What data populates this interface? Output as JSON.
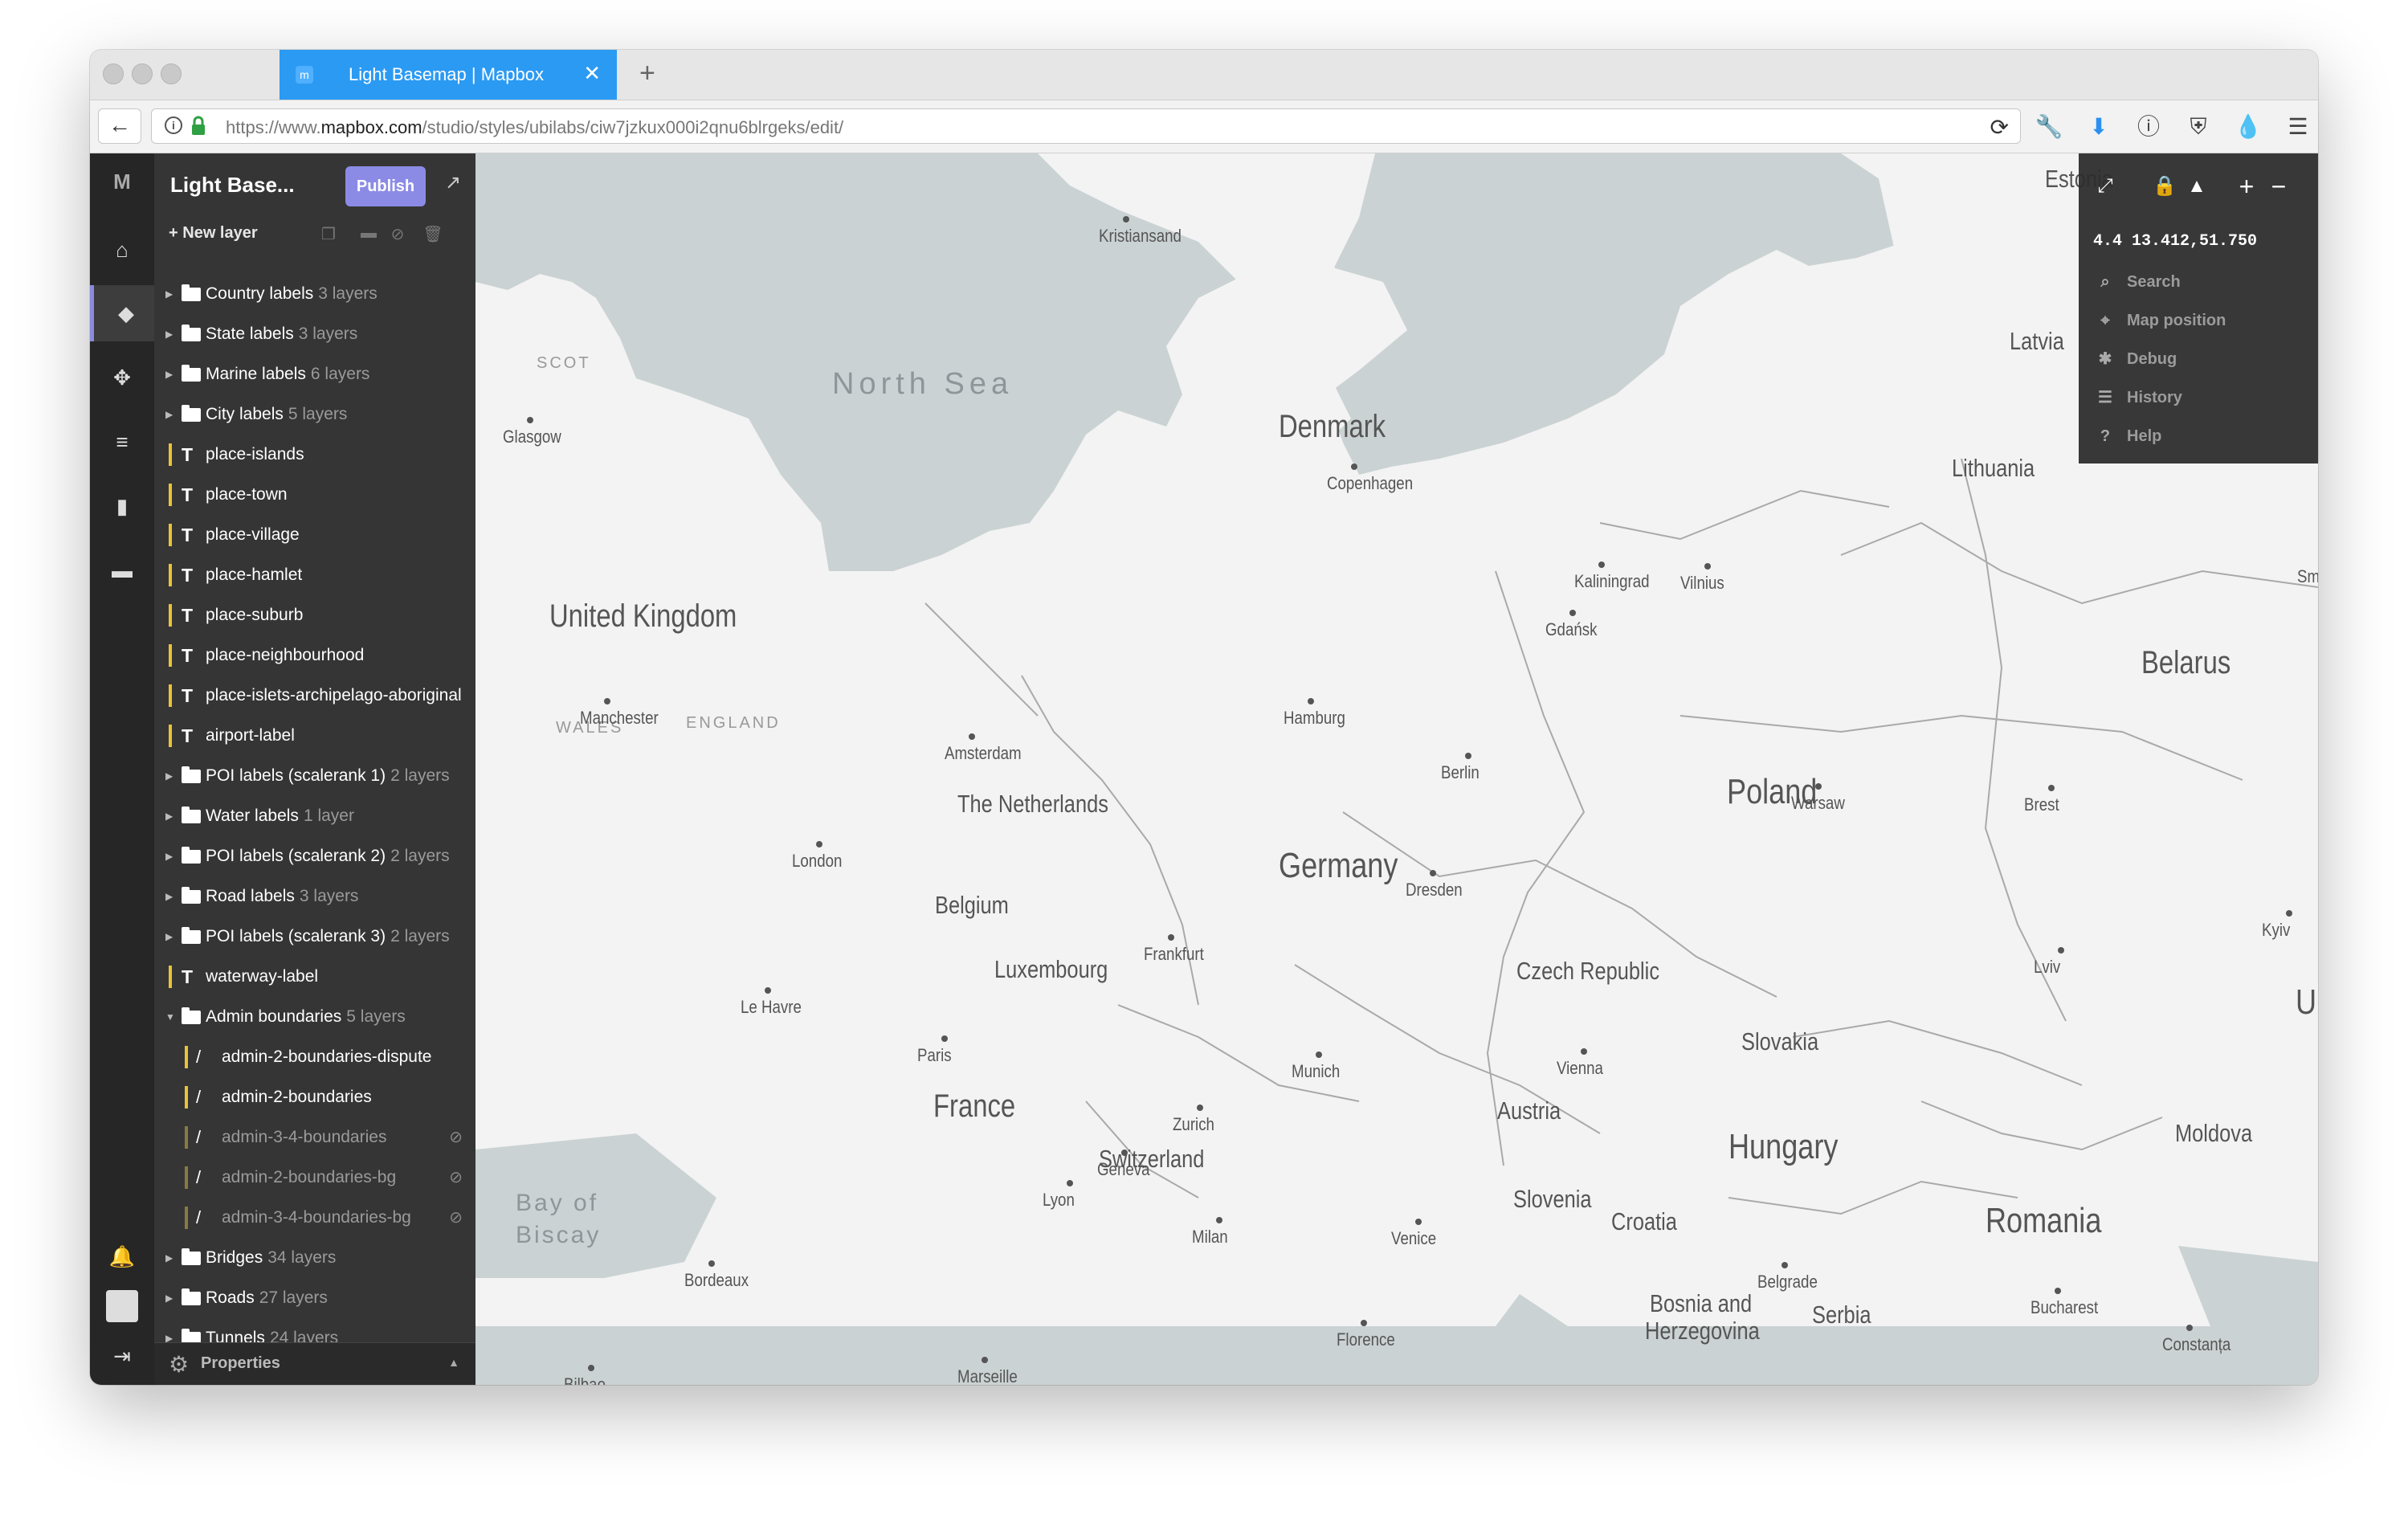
{
  "browser": {
    "tab_title": "Light Basemap | Mapbox",
    "tab_close": "✕",
    "new_tab": "+",
    "url_prefix": "https://www.",
    "url_domain": "mapbox.com",
    "url_path": "/studio/styles/ubilabs/ciw7jzkux000i2qnu6blrgeks/edit/"
  },
  "panel": {
    "style_name": "Light Base...",
    "publish_label": "Publish",
    "new_layer_label": "New layer",
    "properties_label": "Properties",
    "layers": [
      {
        "type": "group",
        "name": "Country labels",
        "count": "3 layers"
      },
      {
        "type": "group",
        "name": "State labels",
        "count": "3 layers"
      },
      {
        "type": "group",
        "name": "Marine labels",
        "count": "6 layers"
      },
      {
        "type": "group",
        "name": "City labels",
        "count": "5 layers"
      },
      {
        "type": "symbol",
        "name": "place-islands"
      },
      {
        "type": "symbol",
        "name": "place-town"
      },
      {
        "type": "symbol",
        "name": "place-village"
      },
      {
        "type": "symbol",
        "name": "place-hamlet"
      },
      {
        "type": "symbol",
        "name": "place-suburb"
      },
      {
        "type": "symbol",
        "name": "place-neighbourhood"
      },
      {
        "type": "symbol",
        "name": "place-islets-archipelago-aboriginal"
      },
      {
        "type": "symbol",
        "name": "airport-label"
      },
      {
        "type": "group",
        "name": "POI labels (scalerank 1)",
        "count": "2 layers"
      },
      {
        "type": "group",
        "name": "Water labels",
        "count": "1 layer"
      },
      {
        "type": "group",
        "name": "POI labels (scalerank 2)",
        "count": "2 layers"
      },
      {
        "type": "group",
        "name": "Road labels",
        "count": "3 layers"
      },
      {
        "type": "group",
        "name": "POI labels (scalerank 3)",
        "count": "2 layers"
      },
      {
        "type": "symbol",
        "name": "waterway-label"
      },
      {
        "type": "group-open",
        "name": "Admin boundaries",
        "count": "5 layers"
      },
      {
        "type": "line",
        "name": "admin-2-boundaries-dispute"
      },
      {
        "type": "line",
        "name": "admin-2-boundaries"
      },
      {
        "type": "line-hidden",
        "name": "admin-3-4-boundaries"
      },
      {
        "type": "line-hidden",
        "name": "admin-2-boundaries-bg"
      },
      {
        "type": "line-hidden",
        "name": "admin-3-4-boundaries-bg"
      },
      {
        "type": "group",
        "name": "Bridges",
        "count": "34 layers"
      },
      {
        "type": "group",
        "name": "Roads",
        "count": "27 layers"
      },
      {
        "type": "group",
        "name": "Tunnels",
        "count": "24 layers"
      }
    ]
  },
  "map_controls": {
    "coords": "4.4 13.412,51.750",
    "menu": [
      "Search",
      "Map position",
      "Debug",
      "History",
      "Help"
    ]
  },
  "map_labels": {
    "countries": [
      "Estonia",
      "Latvia",
      "Lithuania",
      "Denmark",
      "United Kingdom",
      "Belarus",
      "Poland",
      "Germany",
      "The Netherlands",
      "Belgium",
      "Luxembourg",
      "Czech Republic",
      "Ukraine",
      "Slovakia",
      "France",
      "Austria",
      "Hungary",
      "Switzerland",
      "Moldova",
      "Slovenia",
      "Croatia",
      "Romania",
      "Bosnia and",
      "Herzegovina",
      "Serbia"
    ],
    "seas": [
      "North Sea",
      "Bay of",
      "Biscay"
    ],
    "regions": [
      "SCOT",
      "WALES",
      "ENGLAND"
    ],
    "cities": [
      "Kristiansand",
      "Glasgow",
      "Copenhagen",
      "Kaliningrad",
      "Vilnius",
      "Smolensk",
      "Gdańsk",
      "Manchester",
      "Hamburg",
      "Amsterdam",
      "Berlin",
      "Warsaw",
      "Brest",
      "London",
      "Dresden",
      "Kyiv",
      "Frankfurt",
      "Lviv",
      "Le Havre",
      "Paris",
      "Munich",
      "Vienna",
      "Zurich",
      "Geneva",
      "Lyon",
      "Milan",
      "Venice",
      "Belgrade",
      "Bucharest",
      "Bordeaux",
      "Florence",
      "Constanța",
      "Marseille",
      "Bilbao"
    ]
  },
  "colors": {
    "accent": "#8b8be6",
    "tab": "#2b9af3",
    "water": "#cbd2d3",
    "land": "#f3f3f3",
    "panel": "#353535"
  }
}
